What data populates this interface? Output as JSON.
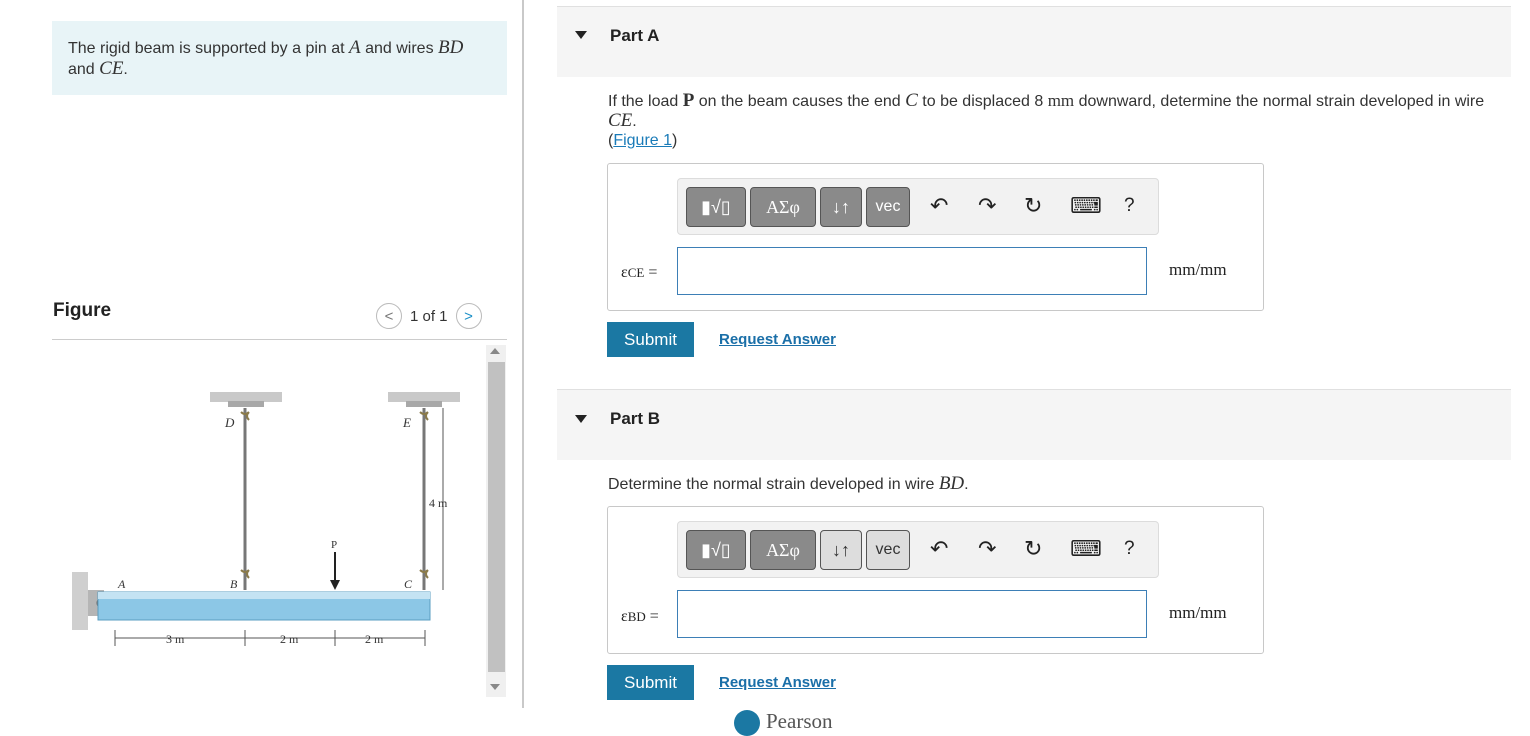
{
  "intro": {
    "pre": "The rigid beam is supported by a pin at ",
    "A": "A",
    "mid": " and wires ",
    "BD": "BD",
    "and": "and ",
    "CE": "CE",
    "end": "."
  },
  "figure_panel": {
    "title": "Figure",
    "pager": "1 of 1",
    "prev": "<",
    "next": ">"
  },
  "diagram": {
    "A": "A",
    "B": "B",
    "C": "C",
    "D": "D",
    "E": "E",
    "P": "P",
    "len": "4 m",
    "d1": "3 m",
    "d2": "2 m",
    "d3": "2 m"
  },
  "partA": {
    "label": "Part A",
    "q1": "If the load ",
    "P": "P",
    "q2": " on the beam causes the end ",
    "C": "C",
    "q3": " to be displaced 8 ",
    "mm": "mm",
    "q4": " downward, determine the normal strain developed in wire",
    "CE": "CE",
    "dot": ".",
    "fig_open": "(",
    "fig_link": "Figure 1",
    "fig_close": ")",
    "var_main": "ε",
    "var_sub": "CE",
    "eq": "=",
    "unit": "mm/mm",
    "submit": "Submit",
    "request": "Request Answer"
  },
  "partB": {
    "label": "Part B",
    "q1": "Determine the normal strain developed in wire ",
    "BD": "BD",
    "dot": ".",
    "var_main": "ε",
    "var_sub": "BD",
    "eq": "=",
    "unit": "mm/mm",
    "submit": "Submit",
    "request": "Request Answer"
  },
  "toolbar": {
    "templates": "▮√▯",
    "greek": "ΑΣφ",
    "arrows": "↓↑",
    "vec": "vec",
    "undo": "↶",
    "redo": "↷",
    "reset": "↻",
    "keyboard": "⌨",
    "help": "?"
  },
  "footer": {
    "brand": "Pearson"
  },
  "colors": {
    "accent": "#1b78a3",
    "intro_bg": "#e8f4f7",
    "beam": "#8cc7e6"
  }
}
